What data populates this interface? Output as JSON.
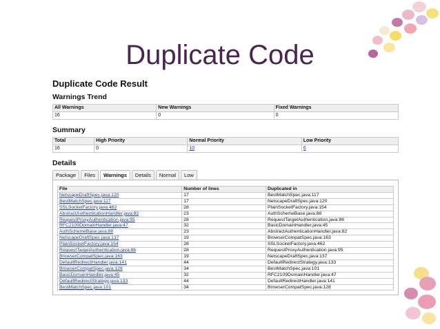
{
  "slide_title": "Duplicate Code",
  "page_heading": "Duplicate Code Result",
  "warnings_trend": {
    "heading": "Warnings Trend",
    "headers": [
      "All Warnings",
      "New Warnings",
      "Fixed Warnings"
    ],
    "values": [
      "16",
      "0",
      "0"
    ]
  },
  "summary": {
    "heading": "Summary",
    "headers": [
      "Total",
      "High Priority",
      "Normal Priority",
      "Low Priority"
    ],
    "values": [
      "16",
      "0",
      "10",
      "6"
    ]
  },
  "details": {
    "heading": "Details",
    "tabs": [
      "Package",
      "Files",
      "Warnings",
      "Details",
      "Normal",
      "Low"
    ],
    "active_tab": "Warnings",
    "headers": [
      "File",
      "Number of lines",
      "Duplicated in"
    ],
    "rows": [
      [
        "NetscapeDraftSpec.java:120",
        "17",
        "BestMatchSpec.java:117"
      ],
      [
        "BestMatchSpec.java:117",
        "17",
        "NetscapeDraftSpec.java:120"
      ],
      [
        "SSLSocketFactory.java:462",
        "28",
        "PlainSocketFactory.java:154"
      ],
      [
        "AbstractAuthenticationHandler.java:82",
        "23",
        "AuthSchemeBase.java:88"
      ],
      [
        "RequestProxyAuthentication.java:95",
        "28",
        "RequestTargetAuthentication.java:86"
      ],
      [
        "RFC2109DomainHandler.java:47",
        "32",
        "BasicDomainHandler.java:45"
      ],
      [
        "AuthSchemeBase.java:88",
        "23",
        "AbstractAuthenticationHandler.java:82"
      ],
      [
        "NetscapeDraftSpec.java:137",
        "19",
        "BrowserCompatSpec.java:163"
      ],
      [
        "PlainSocketFactory.java:154",
        "28",
        "SSLSocketFactory.java:462"
      ],
      [
        "RequestTargetAuthentication.java:86",
        "28",
        "RequestProxyAuthentication.java:95"
      ],
      [
        "BrowserCompatSpec.java:163",
        "19",
        "NetscapeDraftSpec.java:137"
      ],
      [
        "DefaultRedirectHandler.java:141",
        "44",
        "DefaultRedirectStrategy.java:133"
      ],
      [
        "BrowserCompatSpec.java:128",
        "34",
        "BestMatchSpec.java:101"
      ],
      [
        "BasicDomainHandler.java:45",
        "32",
        "RFC2109DomainHandler.java:47"
      ],
      [
        "DefaultRedirectStrategy.java:133",
        "44",
        "DefaultRedirectHandler.java:141"
      ],
      [
        "BestMatchSpec.java:101",
        "34",
        "BrowserCompatSpec.java:128"
      ]
    ]
  },
  "colors": {
    "title": "#4a2451",
    "link": "#1b3d99",
    "header_bg": "#eeeeee",
    "border": "#c8c8c8"
  }
}
